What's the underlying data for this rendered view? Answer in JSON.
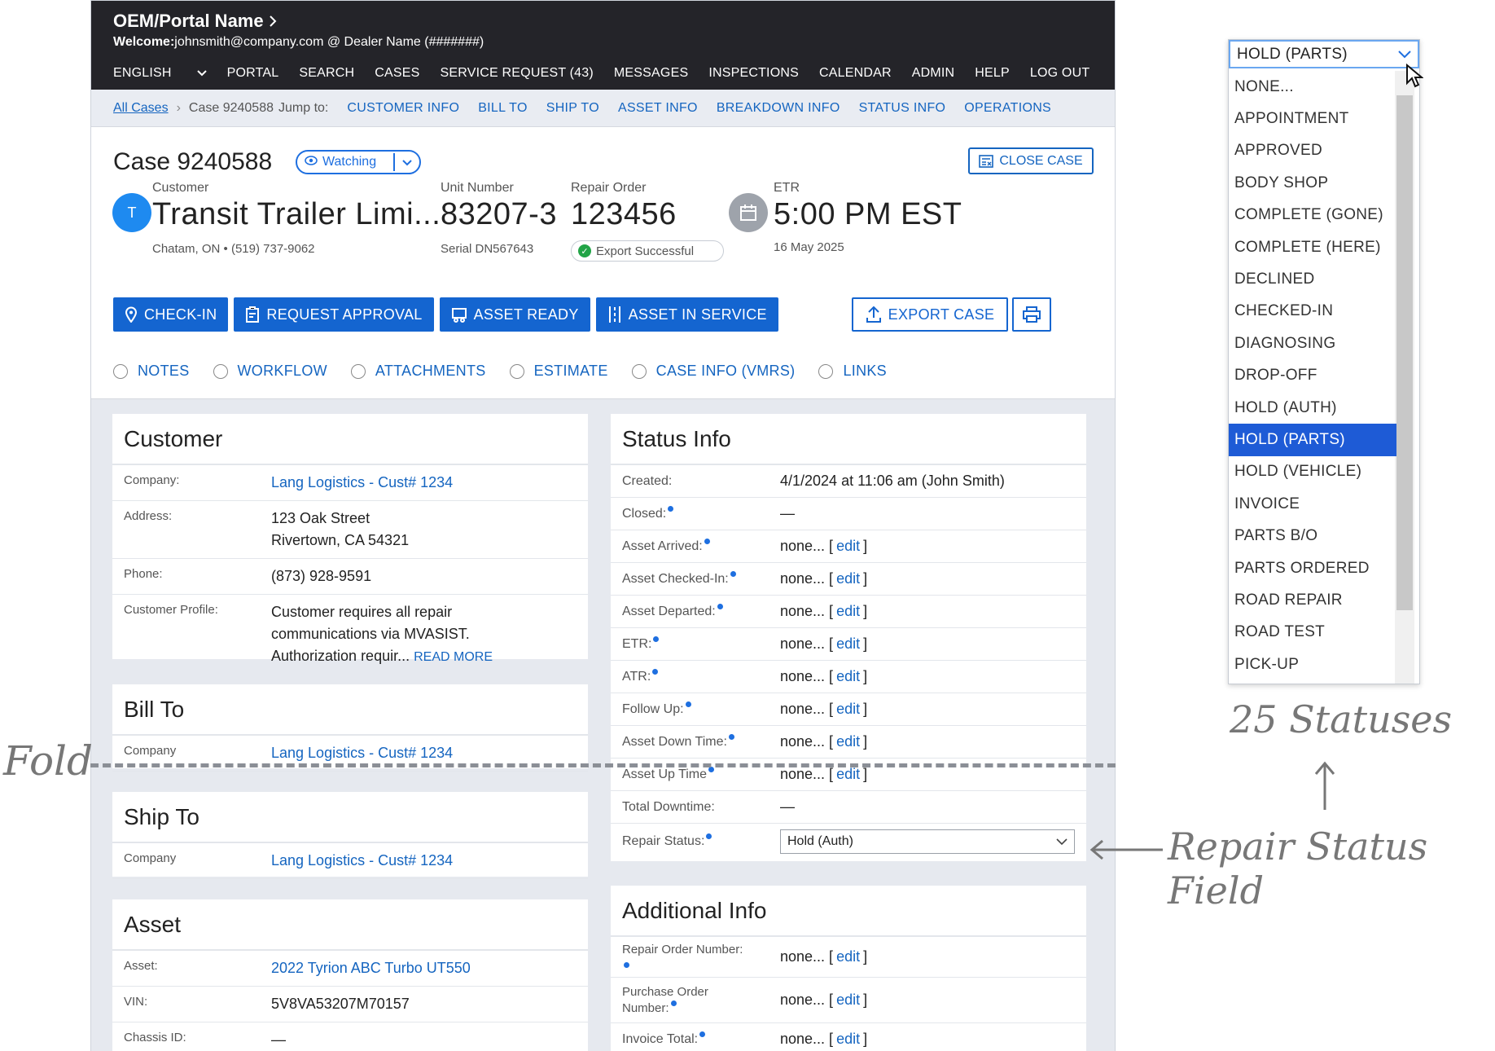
{
  "topbar": {
    "portal_name": "OEM/Portal Name",
    "welcome_label": "Welcome:",
    "welcome_text": "johnsmith@company.com @ Dealer Name (#######)",
    "nav": [
      "ENGLISH",
      "PORTAL",
      "SEARCH",
      "CASES",
      "SERVICE REQUEST (43)",
      "MESSAGES",
      "INSPECTIONS",
      "CALENDAR",
      "ADMIN",
      "HELP",
      "LOG OUT"
    ]
  },
  "breadcrumb": {
    "all_cases": "All Cases",
    "case": "Case 9240588",
    "jump_label": "Jump to:",
    "jumps": [
      "CUSTOMER INFO",
      "BILL TO",
      "SHIP TO",
      "ASSET INFO",
      "BREAKDOWN INFO",
      "STATUS INFO",
      "OPERATIONS"
    ]
  },
  "header": {
    "title": "Case 9240588",
    "watching": "Watching",
    "close_case": "CLOSE CASE",
    "avatar_initial": "T",
    "customer_label": "Customer",
    "customer_name": "Transit Trailer Limi...",
    "customer_sub": "Chatam, ON • (519) 737-9062",
    "unit_label": "Unit Number",
    "unit_value": "83207-3",
    "serial": "Serial DN567643",
    "ro_label": "Repair Order",
    "ro_value": "123456",
    "export_status": "Export Successful",
    "etr_label": "ETR",
    "etr_value": "5:00 PM EST",
    "etr_date": "16 May 2025"
  },
  "actions": {
    "check_in": "CHECK-IN",
    "request_approval": "REQUEST APPROVAL",
    "asset_ready": "ASSET READY",
    "asset_in_service": "ASSET IN SERVICE",
    "export_case": "EXPORT CASE"
  },
  "tabs": [
    "NOTES",
    "WORKFLOW",
    "ATTACHMENTS",
    "ESTIMATE",
    "CASE INFO (VMRS)",
    "LINKS"
  ],
  "customer": {
    "title": "Customer",
    "company_label": "Company:",
    "company": "Lang Logistics - Cust# 1234",
    "address_label": "Address:",
    "address1": "123 Oak Street",
    "address2": "Rivertown, CA 54321",
    "phone_label": "Phone:",
    "phone": "(873) 928-9591",
    "profile_label": "Customer Profile:",
    "profile1": "Customer requires all repair",
    "profile2": "communications via MVASIST.",
    "profile3": "Authorization requir...",
    "read_more": "READ MORE"
  },
  "bill_to": {
    "title": "Bill To",
    "company_label": "Company",
    "company": "Lang Logistics - Cust# 1234"
  },
  "ship_to": {
    "title": "Ship To",
    "company_label": "Company",
    "company": "Lang Logistics - Cust# 1234"
  },
  "asset": {
    "title": "Asset",
    "asset_label": "Asset:",
    "asset": "2022 Tyrion ABC Turbo UT550",
    "vin_label": "VIN:",
    "vin": "5V8VA53207M70157",
    "chassis_label": "Chassis ID:",
    "chassis": "—"
  },
  "status_info": {
    "title": "Status Info",
    "created_label": "Created:",
    "created": "4/1/2024 at 11:06 am (John Smith)",
    "closed_label": "Closed:",
    "closed": "—",
    "none_text": "none...",
    "edit": "edit",
    "rows": [
      "Asset Arrived:",
      "Asset Checked-In:",
      "Asset Departed:",
      "ETR:",
      "ATR:",
      "Follow Up:",
      "Asset Down Time:",
      "Asset Up Time"
    ],
    "total_label": "Total Downtime:",
    "total": "—",
    "repair_label": "Repair Status:",
    "repair_value": "Hold (Auth)"
  },
  "additional": {
    "title": "Additional Info",
    "ro_label": "Repair Order Number:",
    "po_label1": "Purchase Order",
    "po_label2": "Number:",
    "invoice_label": "Invoice Total:"
  },
  "dropdown": {
    "selected": "HOLD (PARTS)",
    "items": [
      "NONE...",
      "APPOINTMENT",
      "APPROVED",
      "BODY SHOP",
      "COMPLETE (GONE)",
      "COMPLETE (HERE)",
      "DECLINED",
      "CHECKED-IN",
      "DIAGNOSING",
      "DROP-OFF",
      "HOLD (AUTH)",
      "HOLD (PARTS)",
      "HOLD (VEHICLE)",
      "INVOICE",
      "PARTS B/O",
      "PARTS ORDERED",
      "ROAD REPAIR",
      "ROAD TEST",
      "PICK-UP"
    ],
    "highlighted_index": 11
  },
  "annotations": {
    "fold": "Fold",
    "statuses": "25 Statuses",
    "repair_field": "Repair Status Field"
  },
  "colors": {
    "brand_blue": "#1465d0",
    "topbar": "#242429",
    "highlight": "#1e5bd6",
    "success": "#22a447"
  }
}
